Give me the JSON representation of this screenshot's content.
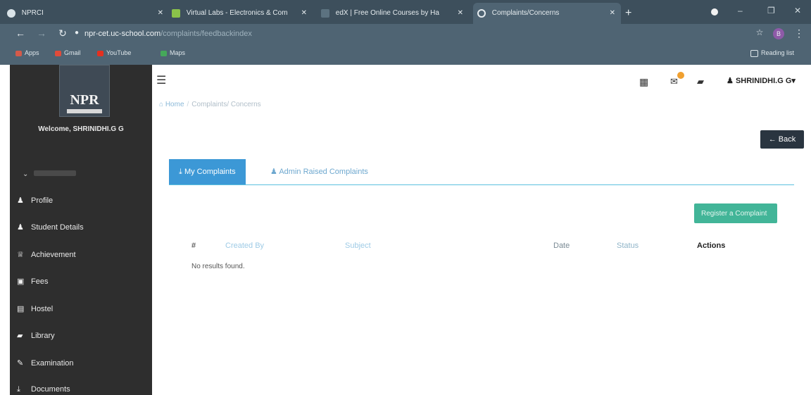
{
  "browser": {
    "tabs": [
      {
        "label": "NPRCI"
      },
      {
        "label": "Virtual Labs - Electronics & Com"
      },
      {
        "label": "edX | Free Online Courses by Ha"
      },
      {
        "label": "Complaints/Concerns"
      }
    ],
    "url_host": "npr-cet.uc-school.com",
    "url_path": "/complaints/feedbackindex",
    "bookmarks": [
      {
        "label": "Apps"
      },
      {
        "label": "Gmail"
      },
      {
        "label": "YouTube"
      },
      {
        "label": "Maps"
      }
    ],
    "reading_list": "Reading list",
    "profile_initial": "B"
  },
  "sidebar": {
    "logo_text": "NPR",
    "welcome": "Welcome, SHRINIDHI.G G",
    "items": [
      {
        "label": "Profile"
      },
      {
        "label": "Student Details"
      },
      {
        "label": "Achievement"
      },
      {
        "label": "Fees"
      },
      {
        "label": "Hostel"
      },
      {
        "label": "Library"
      },
      {
        "label": "Examination"
      },
      {
        "label": "Documents"
      }
    ]
  },
  "header": {
    "breadcrumb_home": "Home",
    "breadcrumb_current": "Complaints/ Concerns",
    "user_name": "SHRINIDHI.G G"
  },
  "main": {
    "back_label": "Back",
    "tabs": [
      {
        "label": "My Complaints"
      },
      {
        "label": "Admin Raised Complaints"
      }
    ],
    "register_label": "Register a Complaint",
    "table": {
      "headers": [
        "#",
        "Created By",
        "Subject",
        "Date",
        "Status",
        "Actions"
      ],
      "empty_text": "No results found."
    }
  },
  "colors": {
    "sidebar_bg": "#2e2e2e",
    "tab_active": "#3c98d6",
    "register_btn": "#42b598",
    "back_btn": "#2a3540"
  }
}
